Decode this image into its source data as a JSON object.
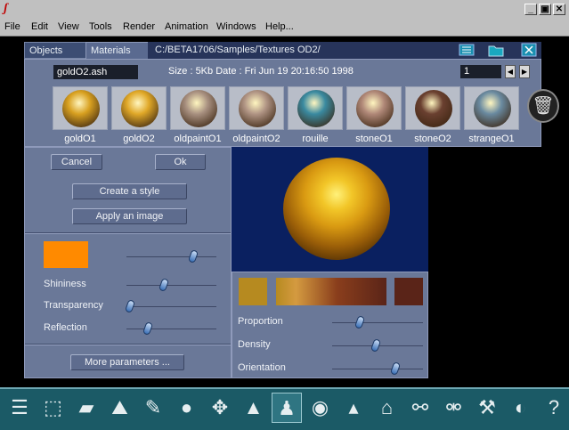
{
  "window": {
    "controls": [
      "_",
      "▣",
      "✕"
    ]
  },
  "menu": [
    "File",
    "Edit",
    "View",
    "Tools",
    "Render",
    "Animation",
    "Windows",
    "Help..."
  ],
  "tabs": {
    "objects": "Objects",
    "materials": "Materials"
  },
  "path": "C:/BETA1706/Samples/Textures OD2/",
  "library": {
    "filename": "goldO2.ash",
    "info": "Size : 5Kb   Date : Fri Jun 19 20:16:50 1998",
    "page": "1",
    "materials": [
      {
        "name": "goldO1",
        "color": "#d8a020"
      },
      {
        "name": "goldO2",
        "color": "#e0a828"
      },
      {
        "name": "oldpaintO1",
        "color": "#a89080"
      },
      {
        "name": "oldpaintO2",
        "color": "#b09484"
      },
      {
        "name": "rouille",
        "color": "#3a8aa0"
      },
      {
        "name": "stoneO1",
        "color": "#b08878"
      },
      {
        "name": "stoneO2",
        "color": "#6a4030"
      },
      {
        "name": "strangeO1",
        "color": "#6a8aa0"
      }
    ]
  },
  "editor": {
    "cancel": "Cancel",
    "ok": "Ok",
    "create_style": "Create a style",
    "apply_image": "Apply an image",
    "base_color": "#ff8a00",
    "sliders": [
      {
        "label": "",
        "value": 0.74
      },
      {
        "label": "Shininess",
        "value": 0.42
      },
      {
        "label": "Transparency",
        "value": 0.04
      },
      {
        "label": "Reflection",
        "value": 0.24
      }
    ],
    "more_params": "More parameters ..."
  },
  "texture": {
    "swatch_color": "#b68a20",
    "end_color": "#5a2418",
    "sliders": [
      {
        "label": "Proportion",
        "value": 0.3
      },
      {
        "label": "Density",
        "value": 0.48
      },
      {
        "label": "Orientation",
        "value": 0.7
      }
    ]
  },
  "toolbar": [
    "layers-icon",
    "cube-icon",
    "paint-brush-icon",
    "terrain-icon",
    "pencil-icon",
    "sphere-icon",
    "move-icon",
    "pyramid-icon",
    "character-icon",
    "eye-icon",
    "cone-icon",
    "ghost-icon",
    "link-icon",
    "unlink-icon",
    "hammer-icon",
    "palette-icon",
    "help-icon"
  ]
}
